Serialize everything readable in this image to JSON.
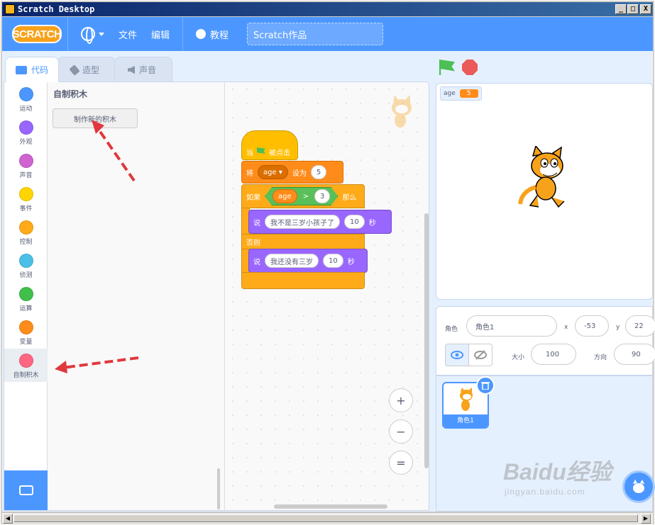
{
  "window": {
    "title": "Scratch Desktop",
    "buttons": [
      "_",
      "□",
      "X"
    ]
  },
  "menubar": {
    "logo": "SCRATCH",
    "language_icon": "globe-icon",
    "file": "文件",
    "edit": "编辑",
    "tutorials": "教程",
    "project_title": "Scratch作品"
  },
  "tabs": [
    {
      "label": "代码",
      "icon": "code-icon",
      "active": true
    },
    {
      "label": "造型",
      "icon": "brush-icon",
      "active": false
    },
    {
      "label": "声音",
      "icon": "speaker-icon",
      "active": false
    }
  ],
  "categories": [
    {
      "label": "运动",
      "color": "#4c97ff"
    },
    {
      "label": "外观",
      "color": "#9966ff"
    },
    {
      "label": "声音",
      "color": "#cf63cf"
    },
    {
      "label": "事件",
      "color": "#ffd500"
    },
    {
      "label": "控制",
      "color": "#ffab19"
    },
    {
      "label": "侦测",
      "color": "#4cbfe6"
    },
    {
      "label": "运算",
      "color": "#40bf4a"
    },
    {
      "label": "变量",
      "color": "#ff8c1a"
    },
    {
      "label": "自制积木",
      "color": "#ff6680"
    }
  ],
  "palette": {
    "title": "自制积木",
    "make_block": "制作新的积木"
  },
  "script": {
    "when_prefix": "当",
    "when_suffix": "被点击",
    "set_label": "将",
    "set_var": "age",
    "set_to": "设为",
    "set_value": "5",
    "if_label": "如果",
    "cond_var": "age",
    "cond_op": ">",
    "cond_value": "3",
    "then_label": "那么",
    "say1_label": "说",
    "say1_text": "我不是三岁小孩子了",
    "say1_secs": "10",
    "say1_unit": "秒",
    "else_label": "否则",
    "say2_label": "说",
    "say2_text": "我还没有三岁",
    "say2_secs": "10",
    "say2_unit": "秒"
  },
  "zoom": {
    "in": "+",
    "out": "−",
    "reset": "="
  },
  "stage": {
    "monitor_label": "age",
    "monitor_value": "5"
  },
  "sprite_info": {
    "sprite_label": "角色",
    "sprite_name": "角色1",
    "x_label": "x",
    "x_value": "-53",
    "y_label": "y",
    "y_value": "22",
    "show_label": "显示",
    "size_label": "大小",
    "size_value": "100",
    "direction_label": "方向",
    "direction_value": "90"
  },
  "sprites": [
    {
      "name": "角色1"
    }
  ],
  "watermark": {
    "brand": "Baidu经验",
    "url": "jingyan.baidu.com"
  }
}
